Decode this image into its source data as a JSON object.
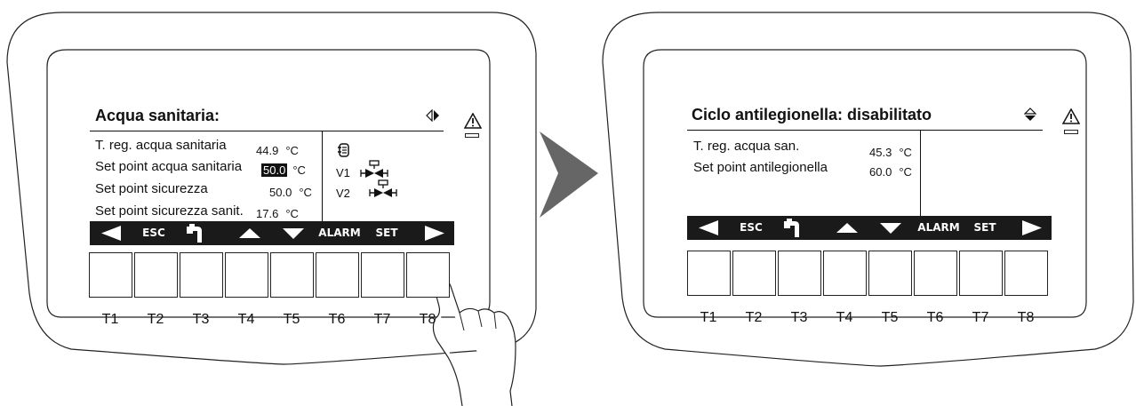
{
  "left_panel": {
    "title": "Acqua sanitaria:",
    "rows": [
      {
        "label": "T. reg. acqua sanitaria",
        "value": "44.9",
        "unit": "°C",
        "highlight": false
      },
      {
        "label": "Set point acqua sanitaria",
        "value": "50.0",
        "unit": "°C",
        "highlight": true
      },
      {
        "label": "Set point sicurezza",
        "value": "50.0",
        "unit": "°C",
        "highlight": false
      },
      {
        "label": "Set point sicurezza sanit.",
        "value": "17.6",
        "unit": "°C",
        "highlight": false
      }
    ],
    "side_labels": [
      "V1",
      "V2"
    ],
    "nav_icon": "left-right-arrows-icon"
  },
  "right_panel": {
    "title": "Ciclo antilegionella: disabilitato",
    "rows": [
      {
        "label": "T. reg. acqua san.",
        "value": "45.3",
        "unit": "°C"
      },
      {
        "label": "Set point antilegionella",
        "value": "60.0",
        "unit": "°C"
      }
    ],
    "nav_icon": "up-down-arrows-icon"
  },
  "softkeys": {
    "esc": "ESC",
    "alarm": "ALARM",
    "set": "SET"
  },
  "key_labels": [
    "T1",
    "T2",
    "T3",
    "T4",
    "T5",
    "T6",
    "T7",
    "T8"
  ],
  "colors": {
    "bar": "#1a1a1a",
    "arrow": "#666666"
  }
}
